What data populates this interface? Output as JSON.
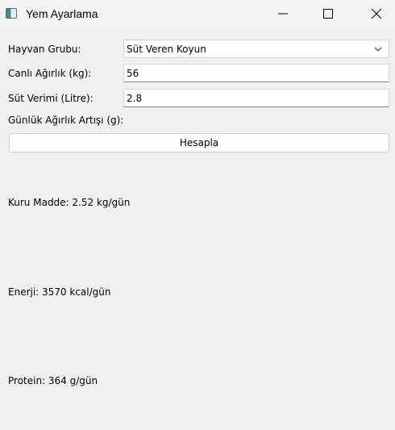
{
  "window": {
    "title": "Yem Ayarlama",
    "app_icon": "app-icon",
    "minimize_icon": "minimize-icon",
    "maximize_icon": "maximize-icon",
    "close_icon": "close-icon"
  },
  "form": {
    "animal_group": {
      "label": "Hayvan Grubu:",
      "value": "Süt Veren Koyun",
      "icon": "chevron-down-icon"
    },
    "live_weight": {
      "label": "Canlı Ağırlık (kg):",
      "value": "56"
    },
    "milk_yield": {
      "label": "Süt Verimi (Litre):",
      "value": "2.8"
    },
    "daily_gain": {
      "label": "Günlük Ağırlık Artışı (g):"
    },
    "calculate_button": "Hesapla"
  },
  "results": {
    "dry_matter": "Kuru Madde: 2.52 kg/gün",
    "energy": "Enerji: 3570 kcal/gün",
    "protein": "Protein: 364 g/gün"
  }
}
